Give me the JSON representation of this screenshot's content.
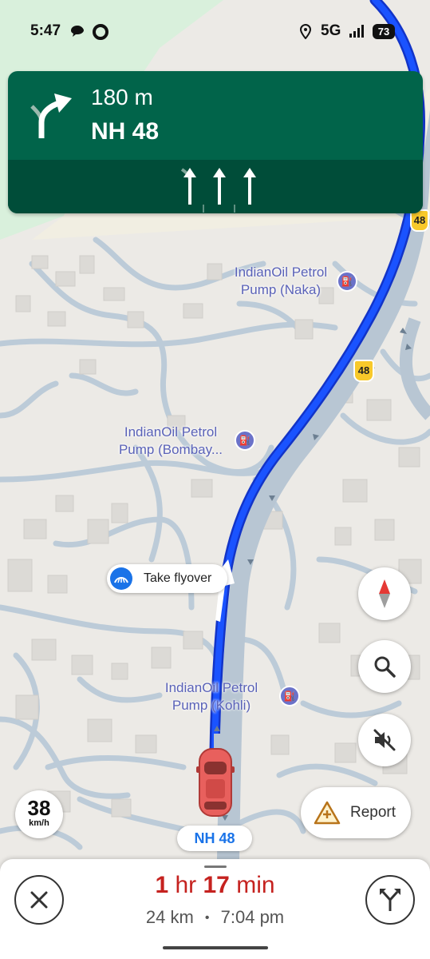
{
  "status_bar": {
    "time": "5:47",
    "network": "5G",
    "battery": "73"
  },
  "banner": {
    "distance": "180 m",
    "road": "NH 48"
  },
  "map": {
    "pois": [
      {
        "name": "IndianOil Petrol\nPump (Naka)"
      },
      {
        "name": "IndianOil Petrol\nPump (Bombay..."
      },
      {
        "name": "IndianOil Petrol\nPump (Kohli)"
      }
    ],
    "highway_shield_1": "48",
    "highway_shield_2": "48",
    "flyover_label": "Take flyover",
    "current_road": "NH 48"
  },
  "speed": {
    "value": "38",
    "unit": "km/h"
  },
  "report_label": "Report",
  "trip": {
    "hr_num": "1",
    "hr_label": "hr",
    "min_num": "17",
    "min_label": "min",
    "distance": "24 km",
    "arrival": "7:04 pm",
    "separator": "•"
  },
  "colors": {
    "banner": "#01644a",
    "route": "#1a3be8",
    "eta": "#c5221f"
  }
}
